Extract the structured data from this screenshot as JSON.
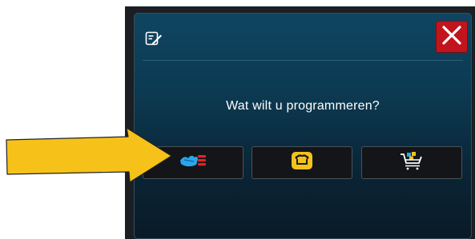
{
  "dialog": {
    "prompt": "Wat wilt u programmeren?",
    "header_icon": "edit-icon",
    "close_icon": "close-icon",
    "close_color": "#c2141c"
  },
  "options": [
    {
      "icon": "cooking-steps-icon"
    },
    {
      "icon": "bread-icon"
    },
    {
      "icon": "basket-icon"
    }
  ],
  "annotation": {
    "type": "arrow",
    "color": "#f6c21a",
    "points_to": "cooking-steps-option"
  }
}
